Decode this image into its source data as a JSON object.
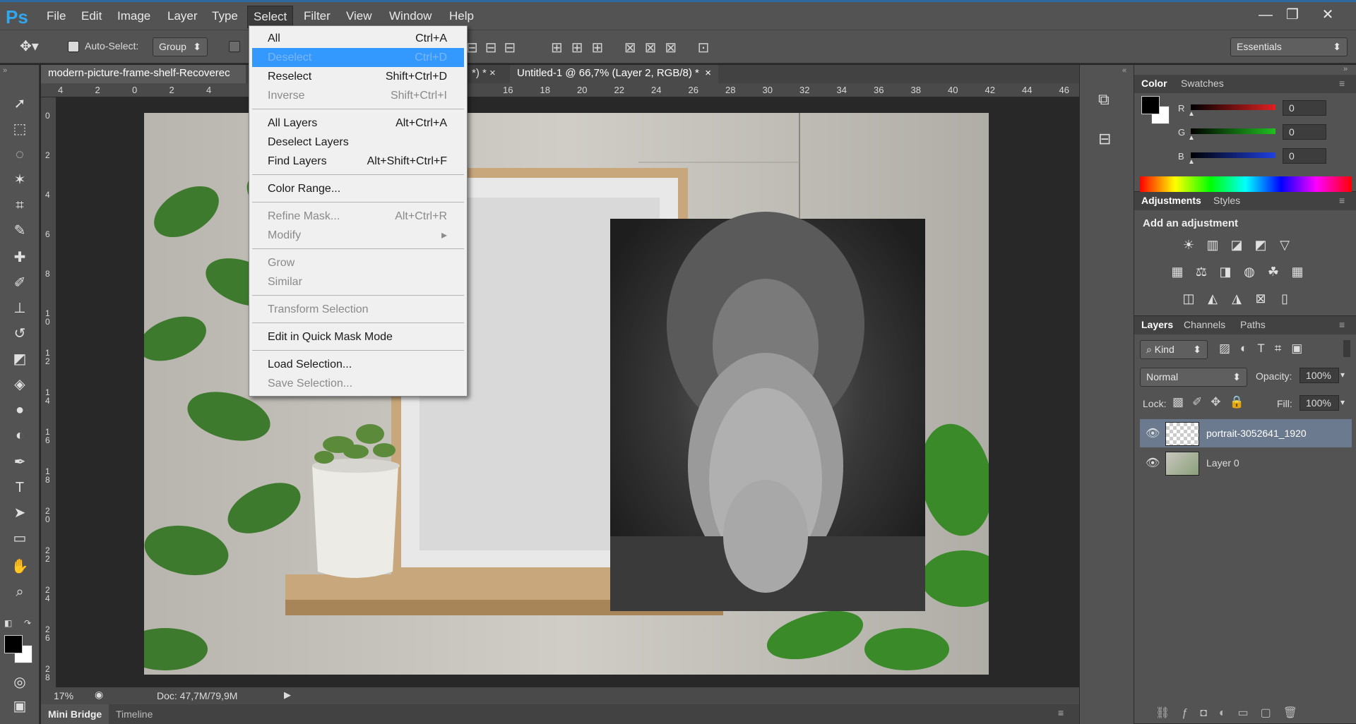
{
  "app": {
    "logo": "Ps"
  },
  "menubar": {
    "items": [
      "File",
      "Edit",
      "Image",
      "Layer",
      "Type",
      "Select",
      "Filter",
      "View",
      "Window",
      "Help"
    ],
    "active": "Select"
  },
  "window_controls": {
    "minimize": "—",
    "restore": "❐",
    "close": "✕"
  },
  "options_bar": {
    "auto_select_label": "Auto-Select:",
    "auto_select_value": "Group",
    "workspace": "Essentials"
  },
  "document_tabs": [
    {
      "label": "modern-picture-frame-shelf-Recoverec",
      "close": ""
    },
    {
      "label": "*) *",
      "close": "×"
    },
    {
      "label": "Untitled-1 @ 66,7% (Layer 2, RGB/8) *",
      "close": "×"
    }
  ],
  "ruler_h": [
    "4",
    "2",
    "0",
    "2",
    "4",
    "",
    "",
    "",
    "",
    "",
    "",
    "",
    "16",
    "18",
    "20",
    "22",
    "24",
    "26",
    "28",
    "30",
    "32",
    "34",
    "36",
    "38",
    "40",
    "42",
    "44",
    "46"
  ],
  "ruler_v": [
    "0",
    "2",
    "4",
    "6",
    "8",
    "1\n0",
    "1\n2",
    "1\n4",
    "1\n6",
    "1\n8",
    "2\n0",
    "2\n2",
    "2\n4",
    "2\n6",
    "2\n8"
  ],
  "select_menu": {
    "items": [
      {
        "label": "All",
        "shortcut": "Ctrl+A",
        "state": "enabled"
      },
      {
        "label": "Deselect",
        "shortcut": "Ctrl+D",
        "state": "highlighted"
      },
      {
        "label": "Reselect",
        "shortcut": "Shift+Ctrl+D",
        "state": "enabled"
      },
      {
        "label": "Inverse",
        "shortcut": "Shift+Ctrl+I",
        "state": "disabled"
      },
      {
        "separator": true
      },
      {
        "label": "All Layers",
        "shortcut": "Alt+Ctrl+A",
        "state": "enabled"
      },
      {
        "label": "Deselect Layers",
        "shortcut": "",
        "state": "enabled"
      },
      {
        "label": "Find Layers",
        "shortcut": "Alt+Shift+Ctrl+F",
        "state": "enabled"
      },
      {
        "separator": true
      },
      {
        "label": "Color Range...",
        "shortcut": "",
        "state": "enabled"
      },
      {
        "separator": true
      },
      {
        "label": "Refine Mask...",
        "shortcut": "Alt+Ctrl+R",
        "state": "disabled"
      },
      {
        "label": "Modify",
        "shortcut": "▸",
        "state": "disabled"
      },
      {
        "separator": true
      },
      {
        "label": "Grow",
        "shortcut": "",
        "state": "disabled"
      },
      {
        "label": "Similar",
        "shortcut": "",
        "state": "disabled"
      },
      {
        "separator": true
      },
      {
        "label": "Transform Selection",
        "shortcut": "",
        "state": "disabled"
      },
      {
        "separator": true
      },
      {
        "label": "Edit in Quick Mask Mode",
        "shortcut": "",
        "state": "enabled"
      },
      {
        "separator": true
      },
      {
        "label": "Load Selection...",
        "shortcut": "",
        "state": "enabled"
      },
      {
        "label": "Save Selection...",
        "shortcut": "",
        "state": "disabled"
      }
    ]
  },
  "status_bar": {
    "zoom": "17%",
    "doc": "Doc: 47,7M/79,9M"
  },
  "bottom_tabs": [
    "Mini Bridge",
    "Timeline"
  ],
  "color_panel": {
    "tabs": [
      "Color",
      "Swatches"
    ],
    "channels": [
      {
        "label": "R",
        "value": "0",
        "color": "#e02020"
      },
      {
        "label": "G",
        "value": "0",
        "color": "#20c020"
      },
      {
        "label": "B",
        "value": "0",
        "color": "#2040e0"
      }
    ]
  },
  "adjustments_panel": {
    "tabs": [
      "Adjustments",
      "Styles"
    ],
    "heading": "Add an adjustment",
    "icons_row1": [
      "brightness-icon",
      "levels-icon",
      "curves-icon",
      "exposure-icon",
      "vibrance-icon"
    ],
    "icons_row2": [
      "hue-saturation-icon",
      "color-balance-icon",
      "black-white-icon",
      "photo-filter-icon",
      "channel-mixer-icon",
      "color-lookup-icon"
    ],
    "icons_row3": [
      "invert-icon",
      "posterize-icon",
      "threshold-icon",
      "selective-color-icon",
      "gradient-map-icon"
    ]
  },
  "layers_panel": {
    "tabs": [
      "Layers",
      "Channels",
      "Paths"
    ],
    "filter_kind": "Kind",
    "blend_mode": "Normal",
    "opacity_label": "Opacity:",
    "opacity_value": "100%",
    "lock_label": "Lock:",
    "fill_label": "Fill:",
    "fill_value": "100%",
    "layers": [
      {
        "name": "portrait-3052641_1920",
        "selected": true
      },
      {
        "name": "Layer 0",
        "selected": false
      }
    ]
  }
}
